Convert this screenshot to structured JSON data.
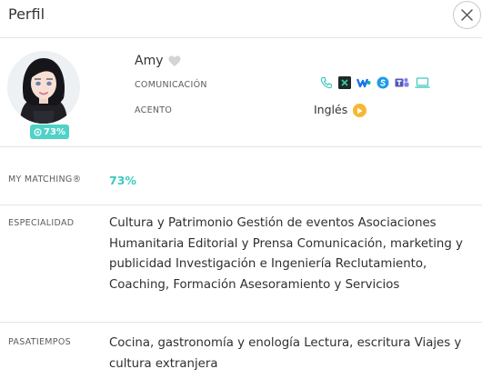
{
  "header": {
    "title": "Perfil"
  },
  "profile": {
    "name": "Amy",
    "match_badge": "73%",
    "communication_label": "COMUNICACIÓN",
    "communication_icons": [
      "phone-icon",
      "zoom-like-icon",
      "webex-icon",
      "skype-icon",
      "teams-icon",
      "laptop-icon"
    ],
    "accent_label": "ACENTO",
    "accent_value": "Inglés"
  },
  "matching": {
    "label": "MY MATCHING®",
    "value": "73%"
  },
  "specialty": {
    "label": "ESPECIALIDAD",
    "text": "Cultura y Patrimonio Gestión de eventos Asociaciones Humanitaria Editorial y Prensa Comunicación, marketing y publicidad Investigación e Ingeniería Reclutamiento, Coaching, Formación Asesoramiento y Servicios"
  },
  "hobbies": {
    "label": "PASATIEMPOS",
    "text": "Cocina, gastronomía y enología Lectura, escritura Viajes y cultura extranjera"
  },
  "colors": {
    "accent_teal": "#4fd2c7",
    "play_orange": "#f7b733",
    "divider": "#e4e4e4"
  }
}
